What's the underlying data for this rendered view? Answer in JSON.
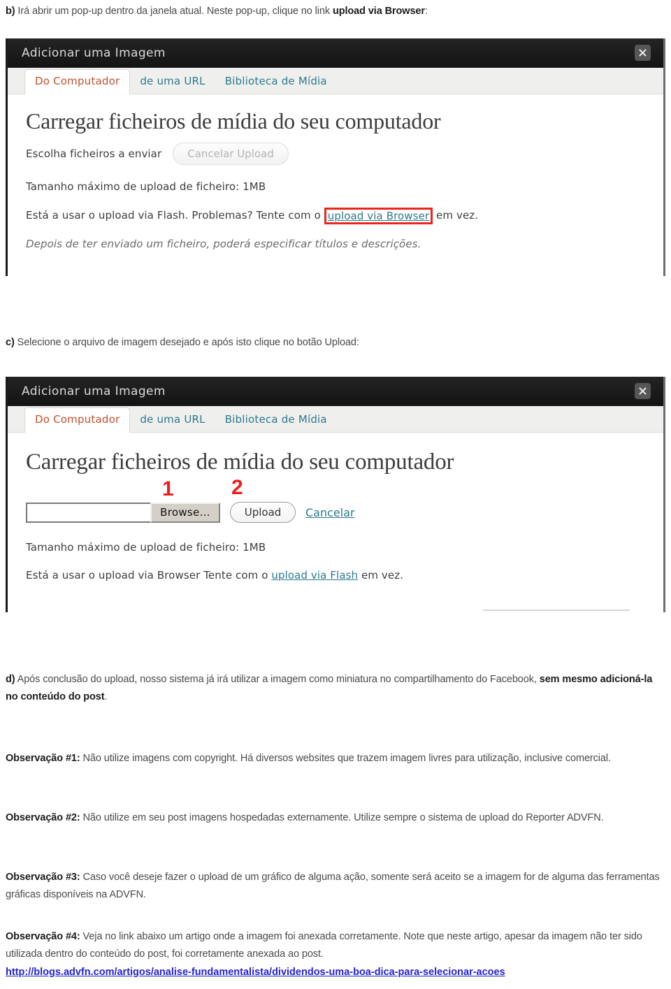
{
  "doc": {
    "step_b": {
      "marker": "b)",
      "text_before": " Irá abrir um pop-up dentro da janela atual. Neste pop-up, clique no link ",
      "bold": "upload via Browser",
      "text_after": ":"
    },
    "step_c": {
      "marker": "c)",
      "text": " Selecione o arquivo de imagem desejado e após isto clique no botão Upload:"
    },
    "step_d": {
      "marker": "d)",
      "text_before": " Após conclusão do upload, nosso sistema já irá utilizar a imagem como miniatura no compartilhamento do Facebook, ",
      "bold": "sem mesmo adicioná-la no conteúdo do post",
      "text_after": "."
    },
    "observacoes": [
      {
        "label": "Observação #1:",
        "text": " Não utilize imagens com copyright. Há diversos websites que trazem imagem livres para utilização, inclusive comercial."
      },
      {
        "label": "Observação #2:",
        "text": " Não utilize em seu post imagens hospedadas externamente. Utilize sempre o sistema de upload do Reporter ADVFN."
      },
      {
        "label": "Observação #3:",
        "text": " Caso você deseje fazer o upload de um gráfico de alguma ação, somente será aceito se a imagem for de alguma das ferramentas gráficas disponíveis na ADVFN."
      },
      {
        "label": "Observação #4:",
        "text": " Veja no link abaixo um artigo onde a imagem foi anexada corretamente. Note que neste artigo, apesar da imagem não ter sido utilizada dentro do conteúdo do post, foi corretamente anexada ao post."
      }
    ],
    "article_link": "http://blogs.advfn.com/artigos/analise-fundamentalista/dividendos-uma-boa-dica-para-selecionar-acoes"
  },
  "dialog_flash": {
    "title": "Adicionar uma Imagem",
    "close_icon": "close-icon",
    "tabs": [
      {
        "label": "Do Computador",
        "active": true
      },
      {
        "label": "de uma URL",
        "active": false
      },
      {
        "label": "Biblioteca de Mídia",
        "active": false
      }
    ],
    "heading": "Carregar ficheiros de mídia do seu computador",
    "choose_label": "Escolha ficheiros a enviar",
    "cancel_upload_button": "Cancelar Upload",
    "max_size_text": "Tamanho máximo de upload de ficheiro:  1MB",
    "flash_notice_before": "Está a usar o upload via Flash. Problemas? Tente com o ",
    "flash_notice_link": "upload via Browser",
    "flash_notice_after": " em vez.",
    "footnote": "Depois de ter enviado um ficheiro, poderá especificar títulos e descrições."
  },
  "dialog_browser": {
    "title": "Adicionar uma Imagem",
    "close_icon": "close-icon",
    "tabs": [
      {
        "label": "Do Computador",
        "active": true
      },
      {
        "label": "de uma URL",
        "active": false
      },
      {
        "label": "Biblioteca de Mídia",
        "active": false
      }
    ],
    "heading": "Carregar ficheiros de mídia do seu computador",
    "file_input_value": "",
    "browse_button": "Browse…",
    "upload_button": "Upload",
    "cancel_link": "Cancelar",
    "callout_1": "1",
    "callout_2": "2",
    "max_size_text": "Tamanho máximo de upload de ficheiro:  1MB",
    "browser_notice_before": "Está a usar o upload via Browser Tente com o ",
    "browser_notice_link": "upload via Flash",
    "browser_notice_after": " em vez."
  },
  "colors": {
    "accent_tab_active": "#c1502e",
    "link_teal": "#2c7a8c",
    "callout_red": "#ee1d1d",
    "highlight_red": "#e8271c",
    "link_blue": "#2222cc",
    "titlebar": "#1d1d1d"
  }
}
